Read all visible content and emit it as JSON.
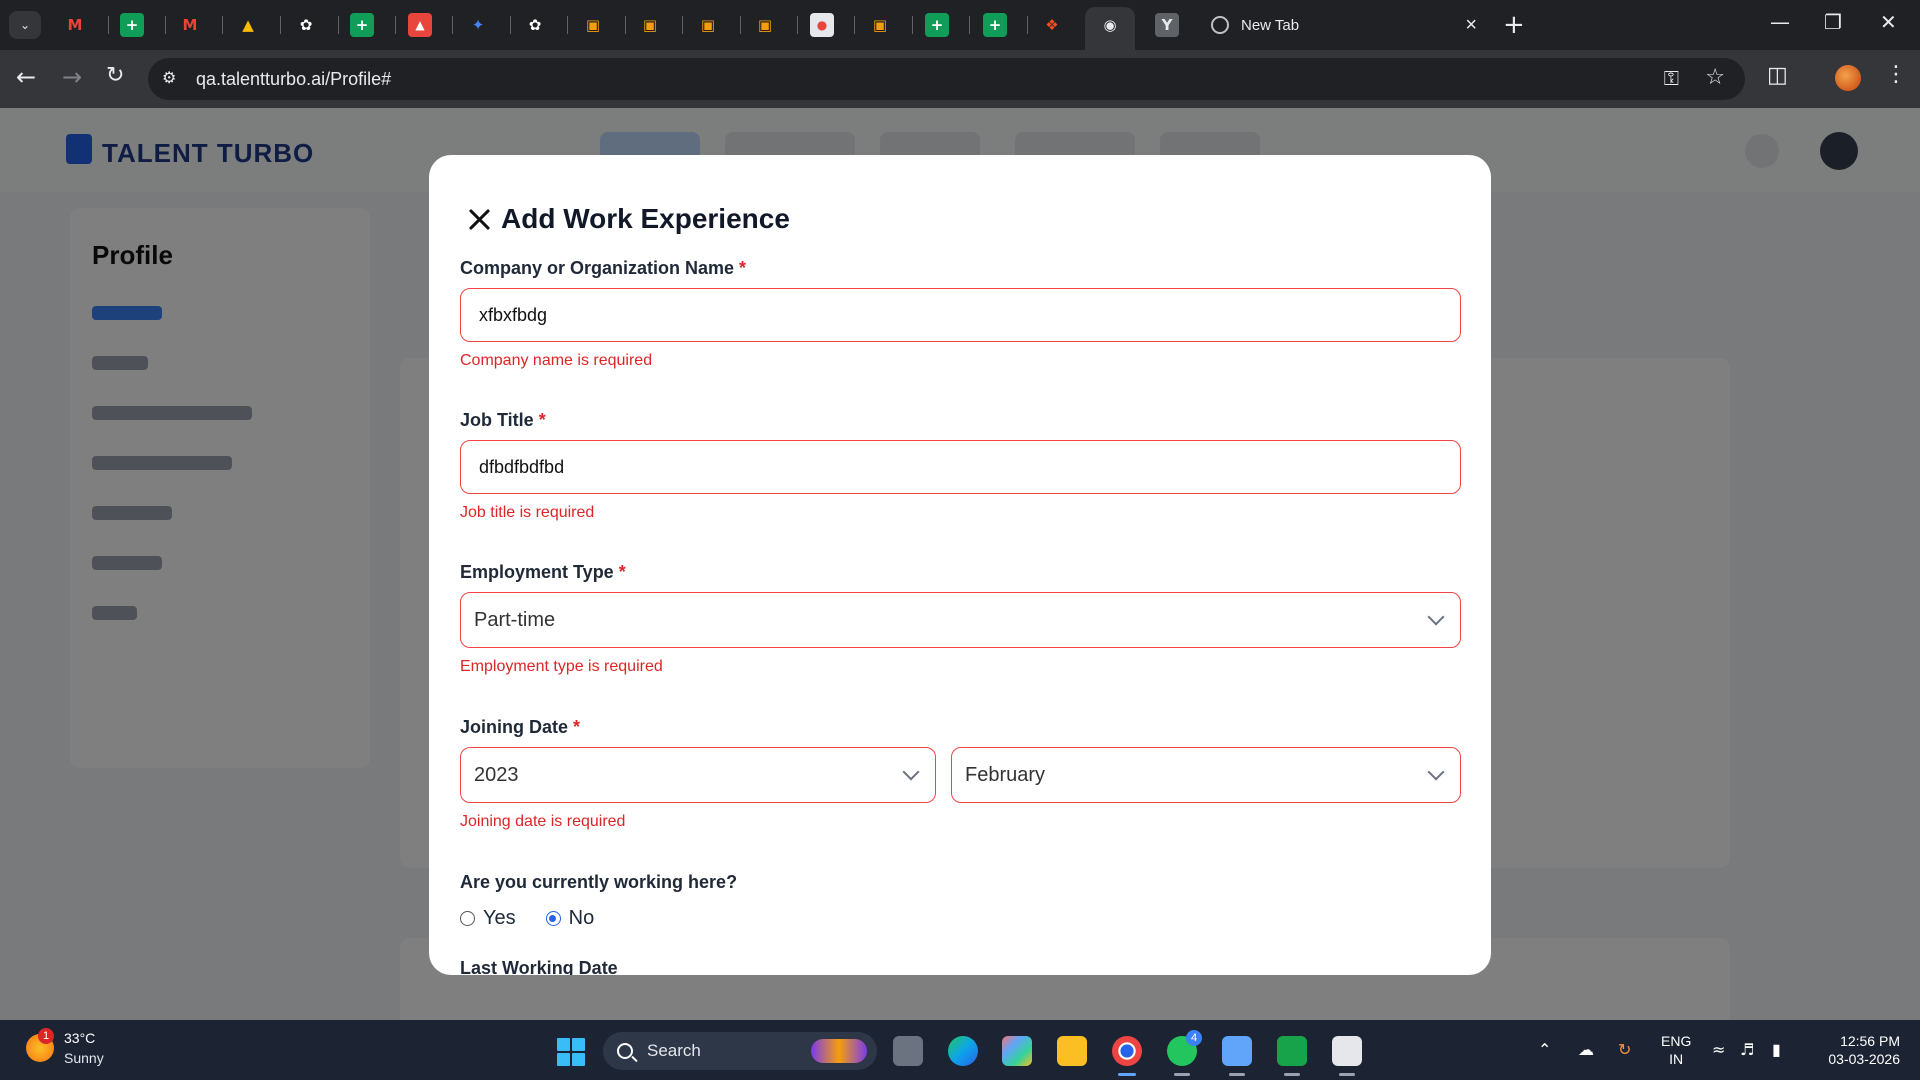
{
  "browser": {
    "tabs": [
      {
        "icon": "tab-list-icon"
      },
      {
        "icon": "gmail-icon",
        "color": "#ea4335"
      },
      {
        "icon": "sheets-icon",
        "color": "#0f9d58"
      },
      {
        "icon": "gmail-icon",
        "color": "#ea4335"
      },
      {
        "icon": "drive-icon",
        "color": "#fbbc04"
      },
      {
        "icon": "chatgpt-icon",
        "color": "#ffffff"
      },
      {
        "icon": "sheets-icon",
        "color": "#0f9d58"
      },
      {
        "icon": "app-icon",
        "color": "#e8453c"
      },
      {
        "icon": "gemini-icon",
        "color": "#4285f4"
      },
      {
        "icon": "chatgpt-icon",
        "color": "#ffffff"
      },
      {
        "icon": "box-icon",
        "color": "#f59e0b"
      },
      {
        "icon": "box-icon",
        "color": "#f59e0b"
      },
      {
        "icon": "box-icon",
        "color": "#f59e0b"
      },
      {
        "icon": "box-icon",
        "color": "#f59e0b"
      },
      {
        "icon": "app-icon",
        "color": "#e5e7eb"
      },
      {
        "icon": "box-icon",
        "color": "#f59e0b"
      },
      {
        "icon": "sheets-icon",
        "color": "#0f9d58"
      },
      {
        "icon": "sheets-icon",
        "color": "#0f9d58"
      },
      {
        "icon": "figma-icon",
        "color": "#f24e1e"
      },
      {
        "icon": "globe-icon",
        "color": "#e8eaed"
      },
      {
        "icon": "y-icon",
        "color": "#e8eaed"
      }
    ],
    "active_tab_title": "New Tab",
    "url": "qa.talentturbo.ai/Profile#"
  },
  "page_bg": {
    "logo": "TALENT TURBO",
    "sidebar_title": "Profile"
  },
  "modal": {
    "title": "Add Work Experience",
    "company": {
      "label": "Company or Organization Name",
      "required_mark": "*",
      "value": "xfbxfbdg",
      "error": "Company name is required"
    },
    "job_title": {
      "label": "Job Title",
      "required_mark": "*",
      "value": "dfbdfbdfbd",
      "error": "Job title is required"
    },
    "employment_type": {
      "label": "Employment Type",
      "required_mark": "*",
      "value": "Part-time",
      "error": "Employment type is required"
    },
    "joining_date": {
      "label": "Joining Date",
      "required_mark": "*",
      "year": "2023",
      "month": "February",
      "error": "Joining date is required"
    },
    "currently_working": {
      "label": "Are you currently working here?",
      "options": [
        "Yes",
        "No"
      ],
      "selected": "No"
    },
    "last_working_date": {
      "label": "Last Working Date"
    }
  },
  "taskbar": {
    "weather_badge": "1",
    "temperature": "33°C",
    "weather": "Sunny",
    "search_placeholder": "Search",
    "whatsapp_badge": "4",
    "lang_line1": "ENG",
    "lang_line2": "IN",
    "time": "12:56 PM",
    "date": "03-03-2026"
  },
  "colors": {
    "error_red": "#dc2626",
    "accent_blue": "#2563eb"
  }
}
